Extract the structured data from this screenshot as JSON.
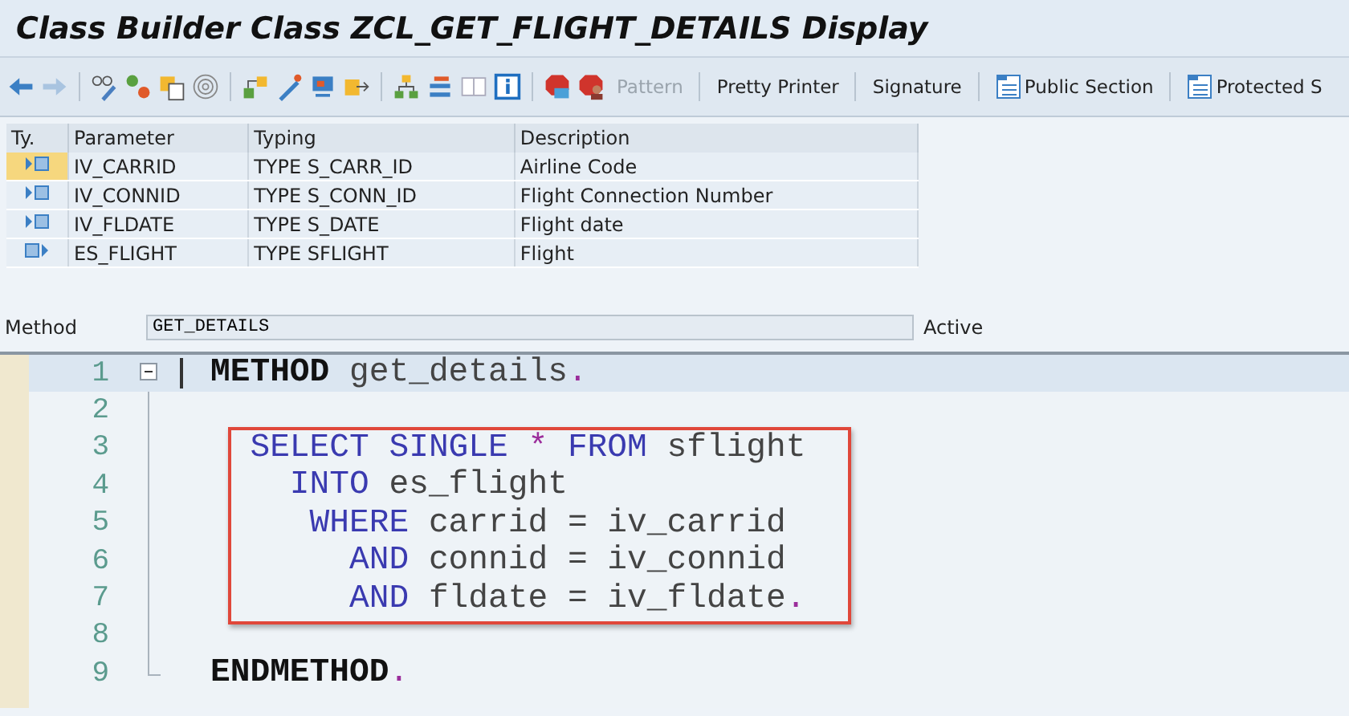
{
  "window": {
    "title": "Class Builder Class ZCL_GET_FLIGHT_DETAILS Display"
  },
  "toolbar": [
    {
      "label": "Pattern",
      "disabled": true,
      "icon": false
    },
    {
      "label": "Pretty Printer",
      "disabled": false,
      "icon": false
    },
    {
      "label": "Signature",
      "disabled": false,
      "icon": false
    },
    {
      "label": "Public Section",
      "disabled": false,
      "icon": true
    },
    {
      "label": "Protected S",
      "disabled": false,
      "icon": true
    }
  ],
  "parameters": {
    "columns": [
      "Ty.",
      "Parameter",
      "Typing",
      "Description"
    ],
    "rows": [
      {
        "kind": "importing",
        "selected": true,
        "parameter": "IV_CARRID",
        "typing": "TYPE S_CARR_ID",
        "description": "Airline Code"
      },
      {
        "kind": "importing",
        "selected": false,
        "parameter": "IV_CONNID",
        "typing": "TYPE S_CONN_ID",
        "description": "Flight Connection Number"
      },
      {
        "kind": "importing",
        "selected": false,
        "parameter": "IV_FLDATE",
        "typing": "TYPE S_DATE",
        "description": "Flight date"
      },
      {
        "kind": "exporting",
        "selected": false,
        "parameter": "ES_FLIGHT",
        "typing": "TYPE SFLIGHT",
        "description": "Flight"
      }
    ]
  },
  "method": {
    "label": "Method",
    "value": "GET_DETAILS",
    "status": "Active"
  },
  "editor": {
    "lines": [
      {
        "number": "1",
        "current": true,
        "boxed": false,
        "collapsible": true,
        "tokens": [
          {
            "kind": "bold",
            "text": "METHOD"
          },
          {
            "kind": "plain",
            "text": " get_details"
          },
          {
            "kind": "punct",
            "text": "."
          }
        ]
      },
      {
        "number": "2",
        "current": false,
        "boxed": false,
        "collapsible": false
      },
      {
        "number": "3",
        "current": false,
        "boxed": true,
        "collapsible": false,
        "tokens": [
          {
            "kind": "keyword",
            "text": "  SELECT SINGLE"
          },
          {
            "kind": "punct",
            "text": " *"
          },
          {
            "kind": "keyword",
            "text": " FROM"
          },
          {
            "kind": "plain",
            "text": " sflight"
          }
        ]
      },
      {
        "number": "4",
        "current": false,
        "boxed": true,
        "collapsible": false,
        "tokens": [
          {
            "kind": "keyword",
            "text": "    INTO"
          },
          {
            "kind": "plain",
            "text": " es_flight"
          }
        ]
      },
      {
        "number": "5",
        "current": false,
        "boxed": true,
        "collapsible": false,
        "tokens": [
          {
            "kind": "keyword",
            "text": "     WHERE"
          },
          {
            "kind": "plain",
            "text": " carrid = iv_carrid"
          }
        ]
      },
      {
        "number": "6",
        "current": false,
        "boxed": true,
        "collapsible": false,
        "tokens": [
          {
            "kind": "keyword",
            "text": "       AND"
          },
          {
            "kind": "plain",
            "text": " connid = iv_connid"
          }
        ]
      },
      {
        "number": "7",
        "current": false,
        "boxed": true,
        "collapsible": false,
        "tokens": [
          {
            "kind": "keyword",
            "text": "       AND"
          },
          {
            "kind": "plain",
            "text": " fldate = iv_fldate"
          },
          {
            "kind": "punct",
            "text": "."
          }
        ]
      },
      {
        "number": "8",
        "current": false,
        "boxed": false,
        "collapsible": false
      },
      {
        "number": "9",
        "current": false,
        "boxed": false,
        "collapsible": false,
        "tokens": [
          {
            "kind": "bold",
            "text": "ENDMETHOD"
          },
          {
            "kind": "punct",
            "text": "."
          }
        ]
      }
    ]
  }
}
